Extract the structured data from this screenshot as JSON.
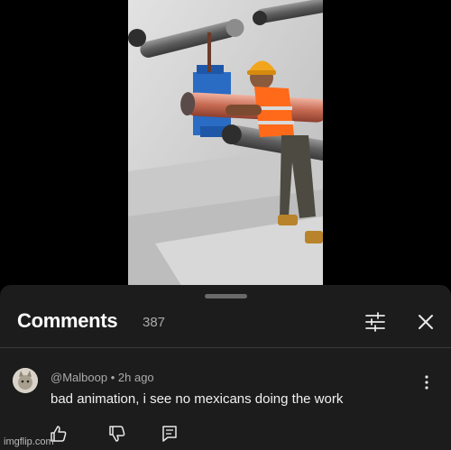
{
  "panel": {
    "title": "Comments",
    "count": "387"
  },
  "comment": {
    "author": "@Malboop",
    "separator": "•",
    "time": "2h ago",
    "text": "bad animation, i see no mexicans doing the work"
  },
  "watermark": "imgflip.com",
  "icons": {
    "filter": "sliders-icon",
    "close": "close-icon",
    "menu": "more-vert-icon",
    "like": "thumb-up-icon",
    "dislike": "thumb-down-icon",
    "reply": "reply-icon"
  },
  "colors": {
    "sheet_bg": "#1c1c1c",
    "text_primary": "#f1f1f1",
    "text_secondary": "#aaaaaa"
  }
}
